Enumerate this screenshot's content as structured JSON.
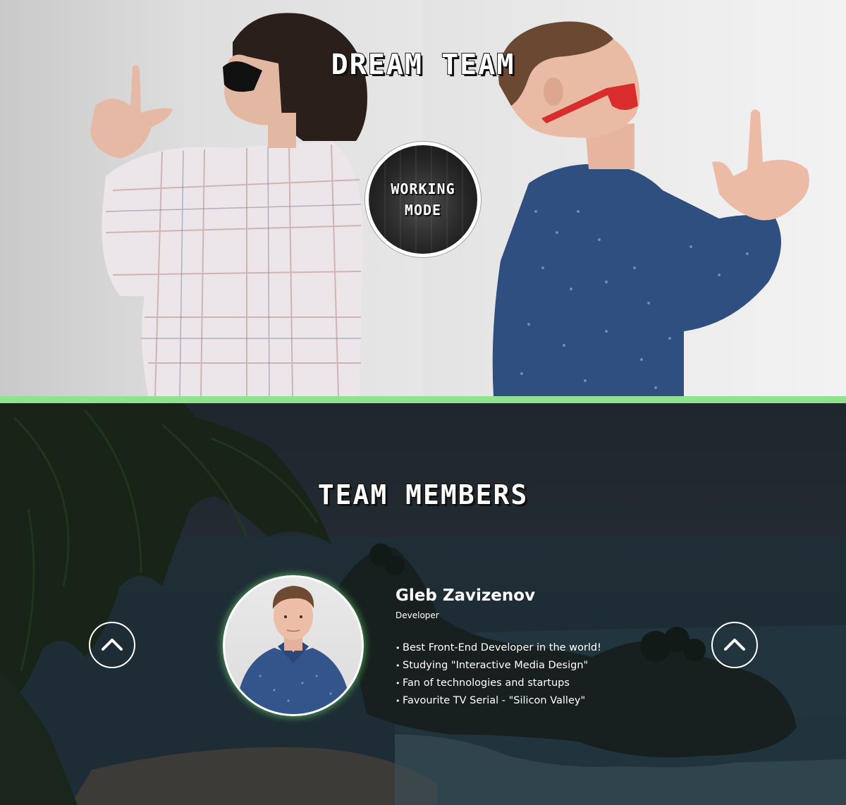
{
  "hero": {
    "title": "Dream Team",
    "badge": {
      "line1": "Working",
      "line2": "Mode"
    }
  },
  "colors": {
    "separator": "#8fe38f",
    "photo_glow": "#6ee66e",
    "text": "#ffffff"
  },
  "team": {
    "title": "Team Members",
    "prev_icon": "chevron-up-icon",
    "next_icon": "chevron-up-icon",
    "member": {
      "name": "Gleb Zavizenov",
      "role": "Developer",
      "facts": [
        "Best Front-End Developer in the world!",
        "Studying \"Interactive Media Design\"",
        "Fan of technologies and startups",
        "Favourite TV Serial - \"Silicon Valley\""
      ]
    }
  }
}
